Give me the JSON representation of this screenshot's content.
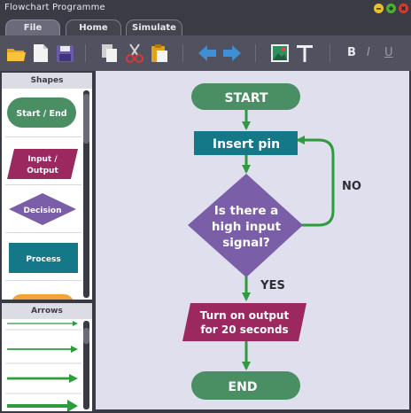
{
  "window": {
    "title": "Flowchart Programme"
  },
  "tabs": [
    "File",
    "Home",
    "Simulate"
  ],
  "toolbar": {
    "bold": "B",
    "italic": "I",
    "underline": "U"
  },
  "shapes_panel": {
    "title": "Shapes",
    "items": [
      "Start / End",
      "Input / Output",
      "Decision",
      "Process"
    ]
  },
  "arrows_panel": {
    "title": "Arrows"
  },
  "flowchart": {
    "start": "START",
    "insert_pin": "Insert pin",
    "question_line1": "Is there a",
    "question_line2": "high input",
    "question_line3": "signal?",
    "no_label": "NO",
    "yes_label": "YES",
    "output_line1": "Turn on output",
    "output_line2": "for 20 seconds",
    "end": "END"
  },
  "colors": {
    "terminal": "#4a8f63",
    "process": "#157888",
    "decision": "#7a5ea8",
    "io": "#9c2860",
    "arrow": "#2e9b3c"
  }
}
